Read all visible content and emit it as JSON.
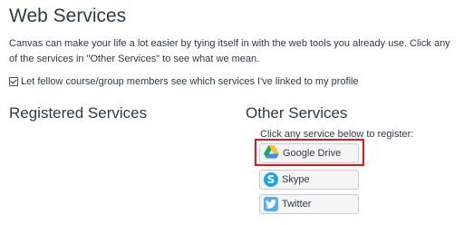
{
  "page": {
    "title": "Web Services",
    "description": "Canvas can make your life a lot easier by tying itself in with the web tools you already use. Click any of the services in \"Other Services\" to see what we mean.",
    "share_checkbox": {
      "label": "Let fellow course/group members see which services I've linked to my profile",
      "checked": true
    }
  },
  "registered": {
    "heading": "Registered Services"
  },
  "other": {
    "heading": "Other Services",
    "hint": "Click any service below to register:",
    "services": [
      {
        "label": "Google Drive",
        "icon": "google-drive-icon",
        "highlighted": true
      },
      {
        "label": "Skype",
        "icon": "skype-icon",
        "highlighted": false
      },
      {
        "label": "Twitter",
        "icon": "twitter-icon",
        "highlighted": false
      }
    ]
  },
  "colors": {
    "text": "#2d3b45",
    "highlight": "#e8141c",
    "button_bg": "#f5f5f5",
    "skype": "#1aa7e6",
    "twitter": "#55acee"
  }
}
